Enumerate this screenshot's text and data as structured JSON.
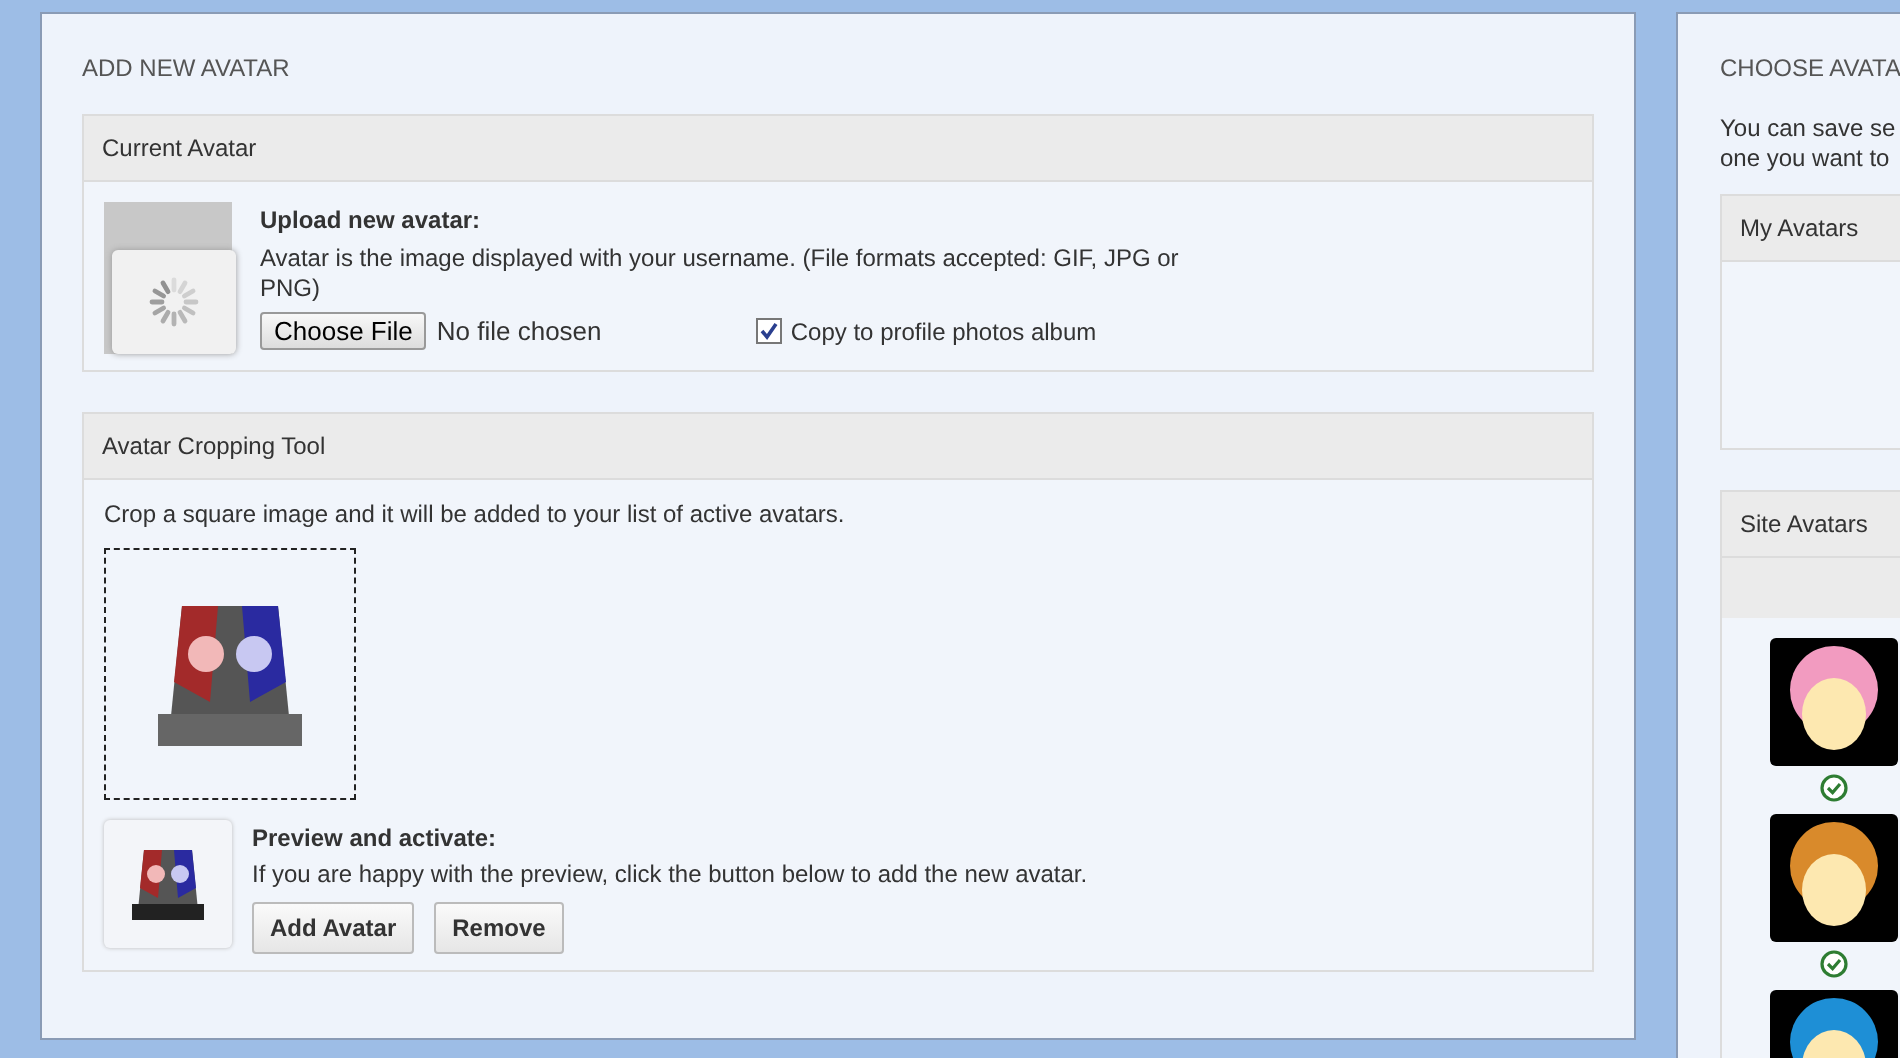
{
  "add_panel": {
    "title": "ADD NEW AVATAR",
    "current": {
      "header": "Current Avatar",
      "upload_title": "Upload new avatar:",
      "description": "Avatar is the image displayed with your username. (File formats accepted: GIF, JPG or PNG)",
      "file_button": "Choose File",
      "file_status": "No file chosen",
      "copy_checkbox": {
        "label": "Copy to profile photos album",
        "checked": true
      }
    },
    "cropping": {
      "header": "Avatar Cropping Tool",
      "instruction": "Crop a square image and it will be added to your list of active avatars.",
      "preview_title": "Preview and activate:",
      "preview_text": "If you are happy with the preview, click the button below to add the new avatar.",
      "buttons": [
        "Add Avatar",
        "Remove"
      ]
    }
  },
  "choose_panel": {
    "title": "CHOOSE AVATA",
    "intro_lines": [
      "You can save se",
      "one you want to"
    ],
    "my_avatars": {
      "header": "My Avatars"
    },
    "site_avatars": {
      "header": "Site Avatars",
      "items": [
        {
          "kind": "granny",
          "active": true
        },
        {
          "kind": "boy",
          "active": true
        },
        {
          "kind": "blue"
        }
      ]
    }
  }
}
